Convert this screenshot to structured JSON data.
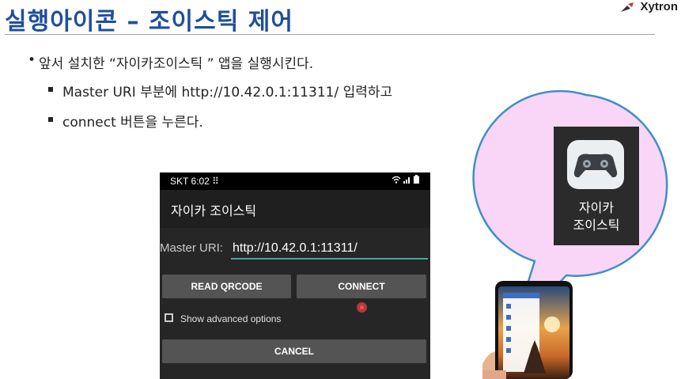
{
  "slide": {
    "title": "실행아이콘 – 조이스틱 제어",
    "logo_text": "Xytron"
  },
  "bullets": {
    "main": "앞서 설치한 “자이카조이스틱 ” 앱을 실행시킨다.",
    "sub1": "Master URI 부분에 http://10.42.0.1:11311/   입력하고",
    "sub2": "connect 버튼을 누른다."
  },
  "phone": {
    "status_time": "SKT 6:02 ⠿",
    "app_title": "자이카 조이스틱",
    "master_uri_label": "Master URI:",
    "master_uri_value": "http://10.42.0.1:11311/",
    "read_qrcode_label": "READ QRCODE",
    "connect_label": "CONNECT",
    "advanced_options_label": "Show advanced options",
    "advanced_options_checked": false,
    "cancel_label": "CANCEL",
    "accent_color": "#4da6a0"
  },
  "app_icon": {
    "icon": "gamepad-icon",
    "label_line1": "자이카",
    "label_line2": "조이스틱",
    "bubble_color": "#f9d6f7",
    "bubble_border": "#3f8ec9"
  },
  "colors": {
    "title": "#1f4e9c",
    "phone_bg": "#262626",
    "button_bg": "#545454"
  }
}
